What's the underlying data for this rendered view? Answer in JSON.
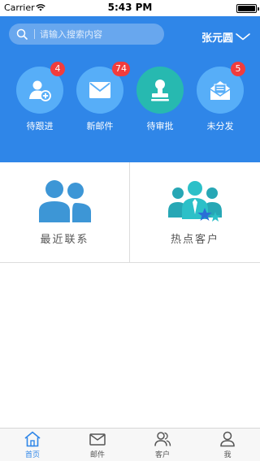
{
  "status_bar": {
    "carrier": "Carrier",
    "time": "5:43 PM"
  },
  "search": {
    "placeholder": "请输入搜索内容"
  },
  "user": {
    "name": "张元圆"
  },
  "colors": {
    "header": "#2f86e8",
    "badge": "#f23c3c",
    "circle_light": "#57aef8",
    "circle_teal": "#27b9b0",
    "tab_active": "#2f86e8"
  },
  "quick_actions": [
    {
      "label": "待跟进",
      "badge": "4",
      "icon": "person-add-icon"
    },
    {
      "label": "新邮件",
      "badge": "74",
      "icon": "mail-icon"
    },
    {
      "label": "待审批",
      "badge": "",
      "icon": "stamp-icon"
    },
    {
      "label": "未分发",
      "badge": "5",
      "icon": "open-mail-icon"
    }
  ],
  "grid": [
    {
      "label": "最近联系",
      "icon": "contacts-icon"
    },
    {
      "label": "热点客户",
      "icon": "hot-customers-icon"
    }
  ],
  "tabs": [
    {
      "label": "首页",
      "icon": "home-icon",
      "active": true
    },
    {
      "label": "邮件",
      "icon": "mail-icon",
      "active": false
    },
    {
      "label": "客户",
      "icon": "customers-icon",
      "active": false
    },
    {
      "label": "我",
      "icon": "profile-icon",
      "active": false
    }
  ]
}
